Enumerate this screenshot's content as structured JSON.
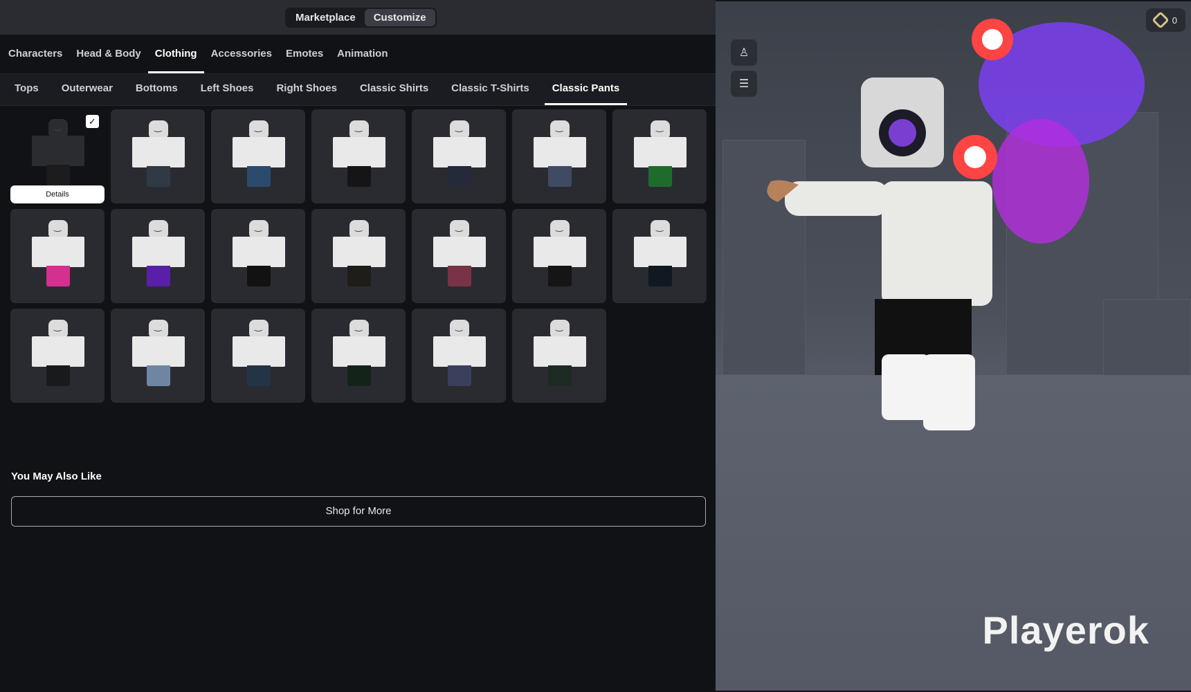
{
  "header": {
    "tabs": [
      {
        "label": "Marketplace",
        "active": false
      },
      {
        "label": "Customize",
        "active": true
      }
    ]
  },
  "main_tabs": [
    {
      "label": "Characters",
      "active": false
    },
    {
      "label": "Head & Body",
      "active": false
    },
    {
      "label": "Clothing",
      "active": true
    },
    {
      "label": "Accessories",
      "active": false
    },
    {
      "label": "Emotes",
      "active": false
    },
    {
      "label": "Animation",
      "active": false
    }
  ],
  "sub_tabs": [
    {
      "label": "Tops",
      "active": false
    },
    {
      "label": "Outerwear",
      "active": false
    },
    {
      "label": "Bottoms",
      "active": false
    },
    {
      "label": "Left Shoes",
      "active": false
    },
    {
      "label": "Right Shoes",
      "active": false
    },
    {
      "label": "Classic Shirts",
      "active": false
    },
    {
      "label": "Classic T-Shirts",
      "active": false
    },
    {
      "label": "Classic Pants",
      "active": true
    }
  ],
  "items": [
    {
      "pants_color": "#1c1c1f",
      "selected": true
    },
    {
      "pants_color": "#2f3a44"
    },
    {
      "pants_color": "#2c4a6e"
    },
    {
      "pants_color": "#151518"
    },
    {
      "pants_color": "#252a3a"
    },
    {
      "pants_color": "#3f4b63"
    },
    {
      "pants_color": "#1f6b2b"
    },
    {
      "pants_color": "#d3308f"
    },
    {
      "pants_color": "#5a1fa8"
    },
    {
      "pants_color": "#121212"
    },
    {
      "pants_color": "#1e1d18"
    },
    {
      "pants_color": "#7a3346"
    },
    {
      "pants_color": "#151515"
    },
    {
      "pants_color": "#101820"
    },
    {
      "pants_color": "#181a1c"
    },
    {
      "pants_color": "#6f86a3"
    },
    {
      "pants_color": "#243447"
    },
    {
      "pants_color": "#14231a"
    },
    {
      "pants_color": "#3a3f5c"
    },
    {
      "pants_color": "#1d2b24"
    }
  ],
  "selected_item": {
    "details_label": "Details",
    "check": "✓"
  },
  "also_like": {
    "heading": "You May Also Like",
    "shop_label": "Shop for More"
  },
  "viewport": {
    "robux_balance": "0",
    "watermark": "Playerok"
  },
  "colors": {
    "accent": "#ffffff",
    "panel": "#111216",
    "tile": "#2a2b31"
  }
}
